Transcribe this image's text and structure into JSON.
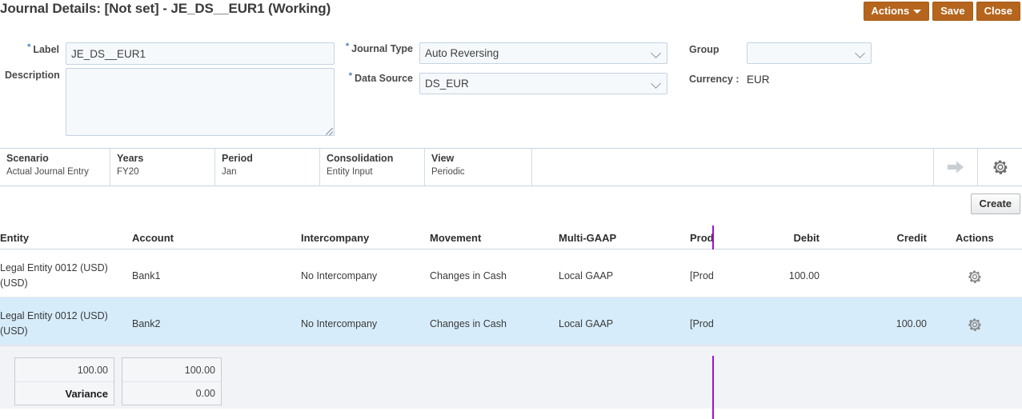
{
  "header": {
    "title": "Journal Details: [Not set] - JE_DS__EUR1 (Working)",
    "actions_label": "Actions",
    "save_label": "Save",
    "close_label": "Close",
    "button_color": "#b5651d"
  },
  "form": {
    "required_marker": "*",
    "label_field": {
      "label": "Label",
      "value": "JE_DS__EUR1",
      "placeholder": ""
    },
    "description_field": {
      "label": "Description",
      "value": "",
      "placeholder": ""
    },
    "journal_type_field": {
      "label": "Journal Type",
      "value": "Auto Reversing"
    },
    "data_source_field": {
      "label": "Data Source",
      "value": "DS_EUR"
    },
    "group_field": {
      "label": "Group",
      "value": ""
    },
    "currency_field": {
      "label": "Currency :",
      "value": "EUR"
    }
  },
  "pov": {
    "cells": [
      {
        "dimension": "Scenario",
        "member": "Actual Journal Entry"
      },
      {
        "dimension": "Years",
        "member": "FY20"
      },
      {
        "dimension": "Period",
        "member": "Jan"
      },
      {
        "dimension": "Consolidation",
        "member": "Entity Input"
      },
      {
        "dimension": "View",
        "member": "Periodic"
      }
    ],
    "go_icon": "arrow-right-icon",
    "settings_icon": "gear-icon"
  },
  "toolbar": {
    "create_label": "Create"
  },
  "grid": {
    "columns": [
      "Entity",
      "Account",
      "Intercompany",
      "Movement",
      "Multi-GAAP",
      "Prod(",
      "Debit",
      "Credit",
      "Actions"
    ],
    "rows": [
      {
        "entity": "Legal Entity 0012 (USD) (USD)",
        "account": "Bank1",
        "intercompany": "No Intercompany",
        "movement": "Changes in Cash",
        "multi_gaap": "Local GAAP",
        "product": "[Prod",
        "debit": "100.00",
        "credit": "",
        "actions_icon": "gear-icon",
        "selected": false
      },
      {
        "entity": "Legal Entity 0012 (USD) (USD)",
        "account": "Bank2",
        "intercompany": "No Intercompany",
        "movement": "Changes in Cash",
        "multi_gaap": "Local GAAP",
        "product": "[Prod",
        "debit": "",
        "credit": "100.00",
        "actions_icon": "gear-icon",
        "selected": true
      }
    ],
    "splitter_color": "#a012d0"
  },
  "totals": {
    "debit_total": "100.00",
    "variance_label": "Variance",
    "credit_total": "100.00",
    "variance_value": "0.00"
  }
}
